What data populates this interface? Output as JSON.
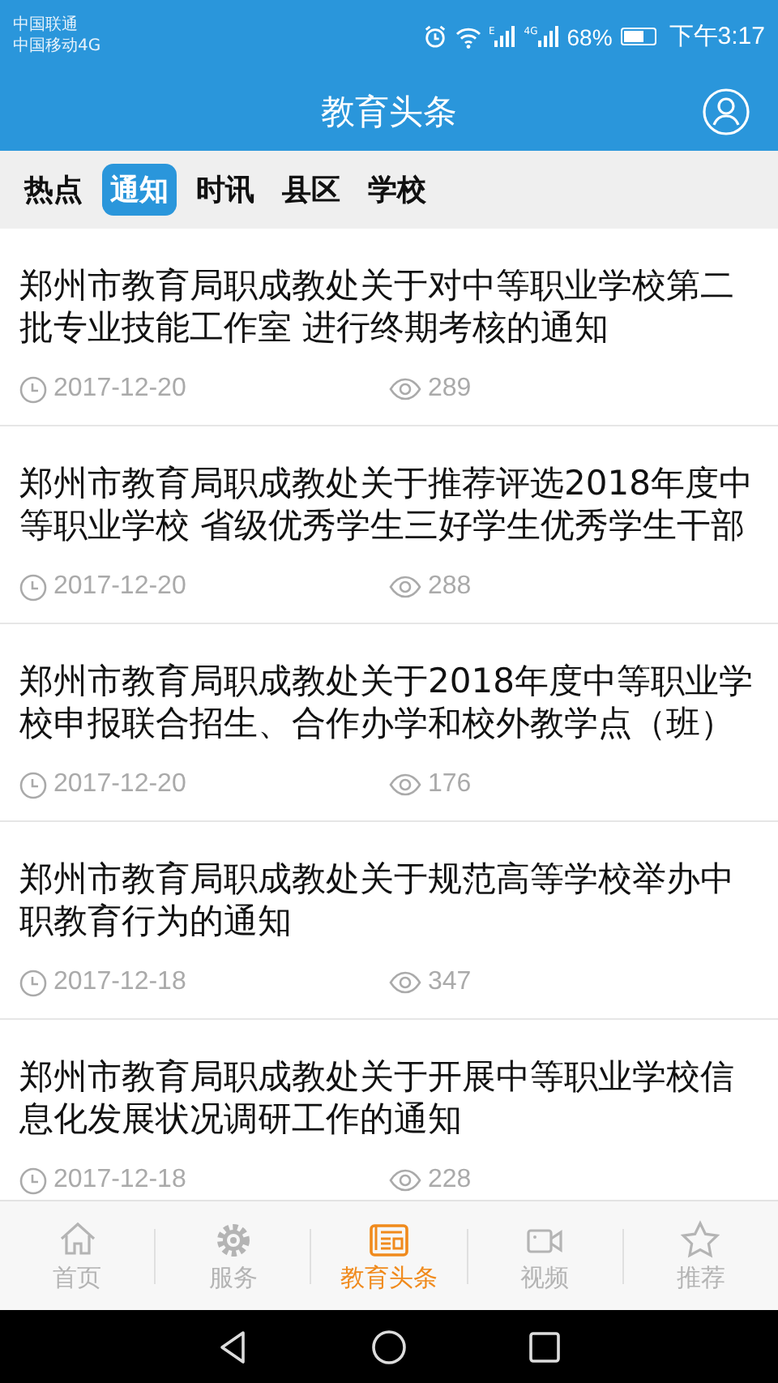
{
  "status_bar": {
    "carriers": [
      "中国联通",
      "中国移动4G"
    ],
    "signals": [
      {
        "label": "E"
      },
      {
        "label": "4G"
      }
    ],
    "battery_text": "68%",
    "time": "下午3:17"
  },
  "header": {
    "title": "教育头条"
  },
  "tabs": [
    {
      "label": "热点",
      "selected": false
    },
    {
      "label": "通知",
      "selected": true
    },
    {
      "label": "时讯",
      "selected": false
    },
    {
      "label": "县区",
      "selected": false
    },
    {
      "label": "学校",
      "selected": false
    }
  ],
  "articles": [
    {
      "title": "郑州市教育局职成教处关于对中等职业学校第二批专业技能工作室 进行终期考核的通知",
      "date": "2017-12-20",
      "views": "289"
    },
    {
      "title": "郑州市教育局职成教处关于推荐评选2018年度中等职业学校 省级优秀学生三好学生优秀学生干部",
      "date": "2017-12-20",
      "views": "288"
    },
    {
      "title": "郑州市教育局职成教处关于2018年度中等职业学校申报联合招生、合作办学和校外教学点（班）",
      "date": "2017-12-20",
      "views": "176"
    },
    {
      "title": "郑州市教育局职成教处关于规范高等学校举办中职教育行为的通知",
      "date": "2017-12-18",
      "views": "347"
    },
    {
      "title": "郑州市教育局职成教处关于开展中等职业学校信息化发展状况调研工作的通知",
      "date": "2017-12-18",
      "views": "228"
    }
  ],
  "bottom_nav": [
    {
      "kind": "home",
      "label": "首页",
      "selected": false
    },
    {
      "kind": "gear",
      "label": "服务",
      "selected": false
    },
    {
      "kind": "news",
      "label": "教育头条",
      "selected": true
    },
    {
      "kind": "video",
      "label": "视频",
      "selected": false
    },
    {
      "kind": "star",
      "label": "推荐",
      "selected": false
    }
  ]
}
